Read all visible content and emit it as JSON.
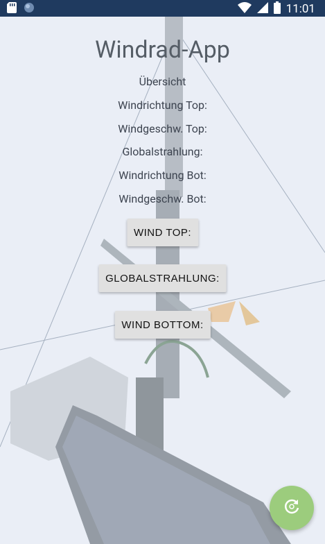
{
  "status_bar": {
    "time": "11:01",
    "icons": [
      "sd-card-icon",
      "circle-icon",
      "wifi-icon",
      "signal-icon",
      "battery-icon"
    ]
  },
  "app": {
    "title": "Windrad-App",
    "overview": "Übersicht",
    "fields": {
      "wind_direction_top": "Windrichtung Top:",
      "wind_speed_top": "Windgeschw. Top:",
      "global_radiation": "Globalstrahlung:",
      "wind_direction_bot": "Windrichtung Bot:",
      "wind_speed_bot": "Windgeschw. Bot:"
    },
    "buttons": {
      "wind_top": "WIND TOP:",
      "global_radiation": "GLOBALSTRAHLUNG:",
      "wind_bottom": "WIND BOTTOM:"
    },
    "fab_icon": "refresh-icon",
    "accent": "#9ccc7d",
    "status_bar_color": "#1f3a5f"
  }
}
